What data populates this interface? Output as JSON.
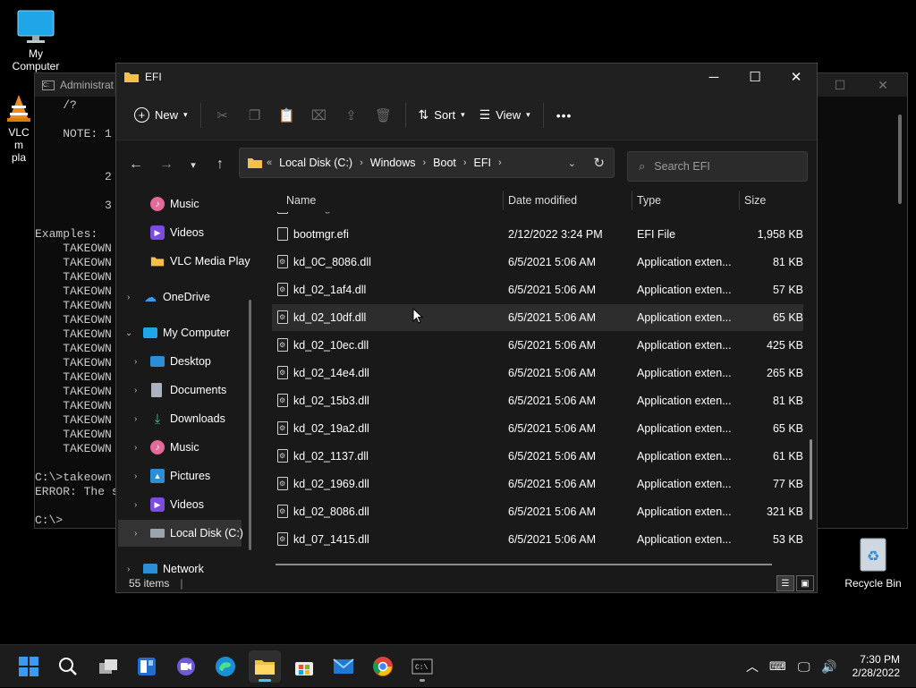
{
  "desktop": {
    "my_computer": "My Computer",
    "vlc_label_1": "VLC m",
    "vlc_label_2": "pla",
    "recycle_bin": "Recycle Bin"
  },
  "console": {
    "title": "Administrat",
    "lines": [
      "    /?",
      "",
      "    NOTE: 1",
      "",
      "",
      "          2",
      "",
      "          3",
      "",
      "Examples:",
      "    TAKEOWN",
      "    TAKEOWN",
      "    TAKEOWN",
      "    TAKEOWN",
      "    TAKEOWN",
      "    TAKEOWN",
      "    TAKEOWN",
      "    TAKEOWN",
      "    TAKEOWN",
      "    TAKEOWN",
      "    TAKEOWN",
      "    TAKEOWN",
      "    TAKEOWN",
      "    TAKEOWN",
      "    TAKEOWN",
      "",
      "C:\\>takeown",
      "ERROR: The s",
      "",
      "C:\\>"
    ]
  },
  "explorer": {
    "title": "EFI",
    "toolbar": {
      "new": "New",
      "sort": "Sort",
      "view": "View",
      "more": "•••"
    },
    "breadcrumb": [
      "Local Disk (C:)",
      "Windows",
      "Boot",
      "EFI"
    ],
    "breadcrumb_prefix": "«",
    "search_placeholder": "Search EFI",
    "nav": {
      "music": "Music",
      "videos": "Videos",
      "vlc": "VLC Media Play",
      "onedrive": "OneDrive",
      "my_computer": "My Computer",
      "desktop": "Desktop",
      "documents": "Documents",
      "downloads": "Downloads",
      "music2": "Music",
      "pictures": "Pictures",
      "videos2": "Videos",
      "local_disk": "Local Disk (C:)",
      "network": "Network"
    },
    "columns": {
      "name": "Name",
      "date": "Date modified",
      "type": "Type",
      "size": "Size"
    },
    "files": [
      {
        "name": "bootmgr.efi",
        "date": "2/12/2022 3:24 PM",
        "type": "EFI File",
        "size": "1,958 KB"
      },
      {
        "name": "kd_0C_8086.dll",
        "date": "6/5/2021 5:06 AM",
        "type": "Application exten...",
        "size": "81 KB"
      },
      {
        "name": "kd_02_1af4.dll",
        "date": "6/5/2021 5:06 AM",
        "type": "Application exten...",
        "size": "57 KB"
      },
      {
        "name": "kd_02_10df.dll",
        "date": "6/5/2021 5:06 AM",
        "type": "Application exten...",
        "size": "65 KB"
      },
      {
        "name": "kd_02_10ec.dll",
        "date": "6/5/2021 5:06 AM",
        "type": "Application exten...",
        "size": "425 KB"
      },
      {
        "name": "kd_02_14e4.dll",
        "date": "6/5/2021 5:06 AM",
        "type": "Application exten...",
        "size": "265 KB"
      },
      {
        "name": "kd_02_15b3.dll",
        "date": "6/5/2021 5:06 AM",
        "type": "Application exten...",
        "size": "81 KB"
      },
      {
        "name": "kd_02_19a2.dll",
        "date": "6/5/2021 5:06 AM",
        "type": "Application exten...",
        "size": "65 KB"
      },
      {
        "name": "kd_02_1137.dll",
        "date": "6/5/2021 5:06 AM",
        "type": "Application exten...",
        "size": "61 KB"
      },
      {
        "name": "kd_02_1969.dll",
        "date": "6/5/2021 5:06 AM",
        "type": "Application exten...",
        "size": "77 KB"
      },
      {
        "name": "kd_02_8086.dll",
        "date": "6/5/2021 5:06 AM",
        "type": "Application exten...",
        "size": "321 KB"
      },
      {
        "name": "kd_07_1415.dll",
        "date": "6/5/2021 5:06 AM",
        "type": "Application exten...",
        "size": "53 KB"
      }
    ],
    "status": "55 items"
  },
  "taskbar": {
    "time": "7:30 PM",
    "date": "2/28/2022"
  },
  "colors": {
    "folder": "#f4c04a",
    "accent": "#4cc2ff",
    "win_blue": "#3a9bf2"
  }
}
